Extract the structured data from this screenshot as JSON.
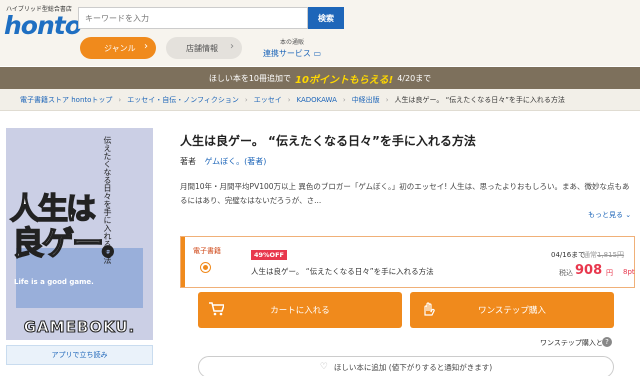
{
  "header": {
    "logo_sub": "ハイブリッド型総合書店",
    "logo": "honto",
    "search_placeholder": "キーワードを入力",
    "search_button": "検索",
    "genre_button": "ジャンル",
    "store_button": "店舗情報",
    "renkei_sub": "本の通販",
    "renkei_main": "連携サービス"
  },
  "promo": {
    "text1": "ほしい本を10冊追加で",
    "points": "10ポイントもらえる!",
    "date": "4/20まで"
  },
  "breadcrumb": [
    "電子書籍ストア hontoトップ",
    "エッセイ・自伝・ノンフィクション",
    "エッセイ",
    "KADOKAWA",
    "中経出版",
    "人生は良ゲー。 “伝えたくなる日々”を手に入れる方法"
  ],
  "cover": {
    "vertical_text": "伝えたくなる日々を手に入れる方法",
    "big1": "人生は",
    "big2": "良ゲー。",
    "english": "Life is a good game.",
    "author": "GAMEBOKU.",
    "app_button": "アプリで立ち読み"
  },
  "product": {
    "title": "人生は良ゲー。 “伝えたくなる日々”を手に入れる方法",
    "author_label": "著者",
    "author_name": "ゲムぼく。(著者)",
    "description": "月間10年・月間平均PV100万以上 異色のブロガー「ゲムぼく。」初のエッセイ! 人生は、思ったよりおもしろい。まあ、微妙な点もあるにはあり、完璧なはないだろうが、さ...",
    "more": "もっと見る"
  },
  "buy": {
    "ebook_label": "電子書籍",
    "discount": "49%OFF",
    "name": "人生は良ゲー。 “伝えたくなる日々”を手に入れる方法",
    "date": "04/16まで",
    "regular_label": "通常",
    "regular_price": "1,815円",
    "tax_label": "税込",
    "price": "908",
    "yen": "円",
    "points": "8pt",
    "cart_button": "カートに入れる",
    "onestep_button": "ワンステップ購入",
    "onestep_link": "ワンステップ購入とは",
    "wish_button": "ほしい本に追加 (値下がりすると通知がきます)"
  },
  "colors": {
    "accent": "#f08a1c",
    "brand": "#1e66b9",
    "sale": "#e8374d",
    "promo_bg": "#7d705c"
  }
}
